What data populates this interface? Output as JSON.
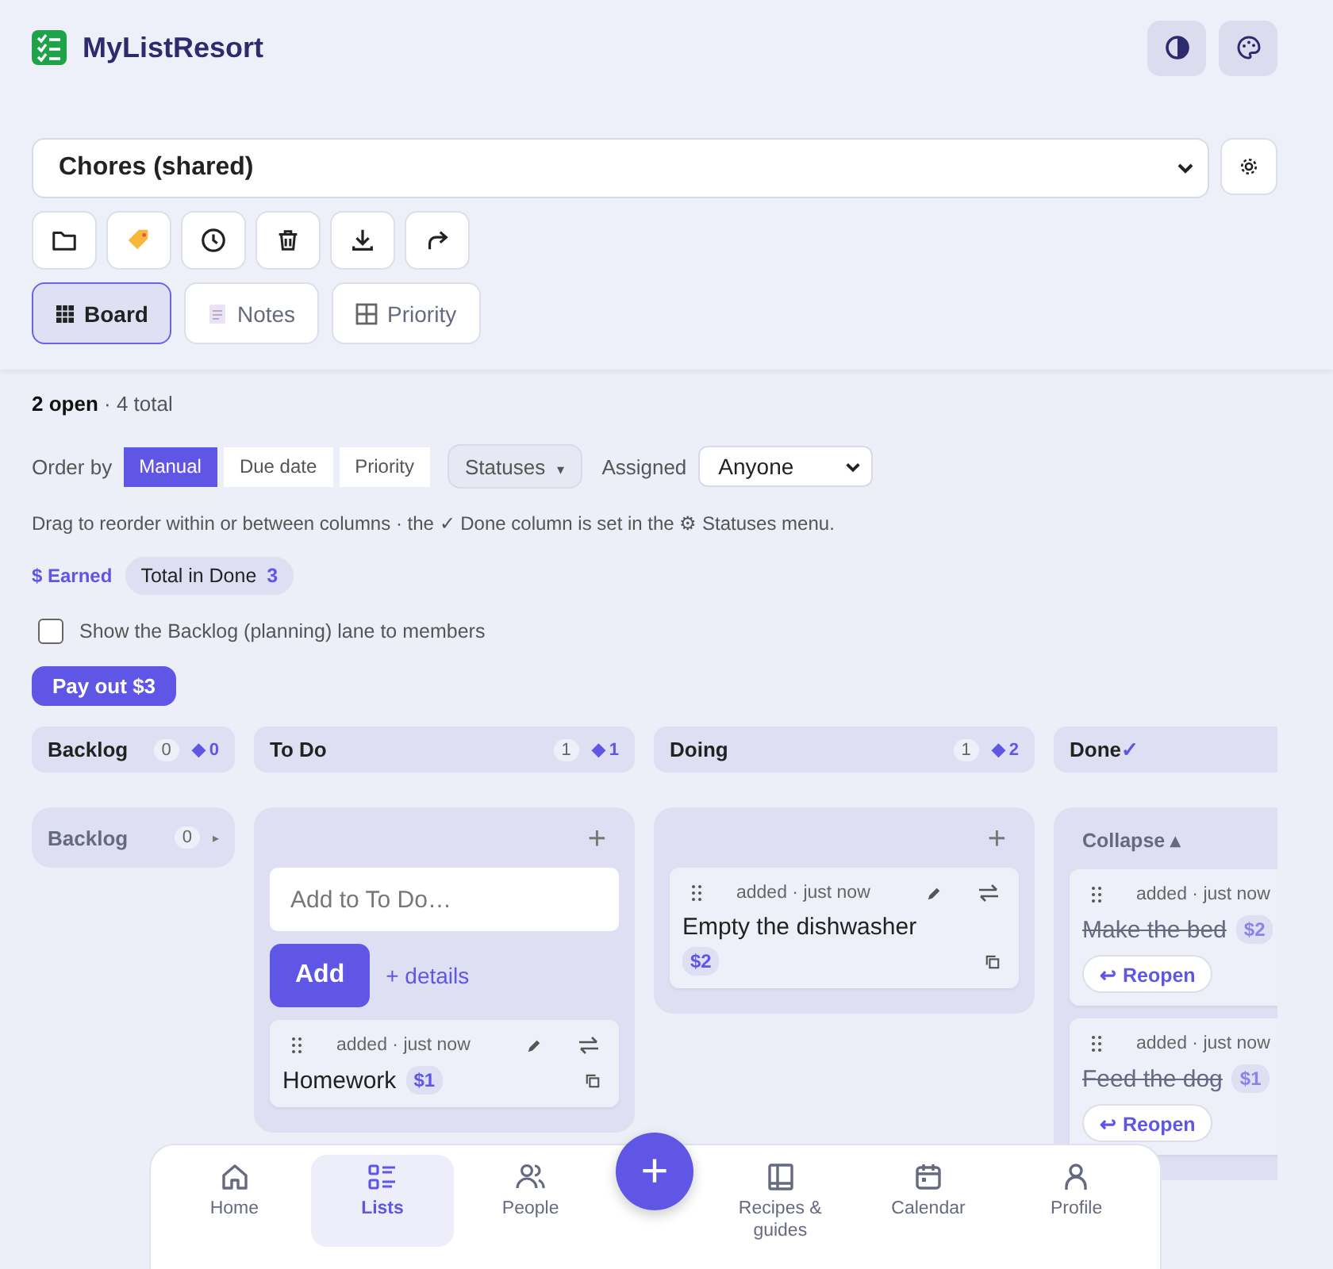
{
  "app": {
    "title": "MyListResort"
  },
  "list_select": {
    "value": "Chores (shared)"
  },
  "views": [
    {
      "label": "Board",
      "kind": "board",
      "selected": true
    },
    {
      "label": "Notes",
      "kind": "notes",
      "selected": false
    },
    {
      "label": "Priority",
      "kind": "priority",
      "selected": false
    }
  ],
  "summary": "**2 open** · 4 total",
  "order_by": {
    "label": "Order by",
    "options": [
      {
        "label": "Manual",
        "selected": true
      },
      {
        "label": "Due date",
        "selected": false
      },
      {
        "label": "Priority",
        "selected": false
      }
    ]
  },
  "statuses_button": {
    "label": "Statuses",
    "caret": "▾"
  },
  "assigned": {
    "label": "Assigned",
    "value": "Anyone"
  },
  "hint": "Drag to reorder within or between columns · the ✓ Done column is set in the ⚙ Statuses menu.",
  "earned": {
    "label": "$ Earned",
    "chip_label": "Total in Done",
    "chip_value": "3"
  },
  "backlog_option": {
    "label": "Show the Backlog (planning) lane to members",
    "checked": false
  },
  "pay_out": "Pay out $3",
  "column_headers": [
    {
      "name": "Backlog",
      "count": "0",
      "points": "◆ 0",
      "kind": "narrow"
    },
    {
      "name": "To Do",
      "count": "1",
      "points": "◆ 1",
      "kind": "wide"
    },
    {
      "name": "Doing",
      "count": "1",
      "points": "◆ 2",
      "kind": "wide"
    },
    {
      "name": "Done",
      "check": "✓",
      "kind": "wide"
    }
  ],
  "lanes": [
    {
      "kind": "collapsed",
      "name": "Backlog",
      "count": "0",
      "toggle": "▸"
    },
    {
      "kind": "open",
      "add_symbol": "+",
      "input": {
        "placeholder": "Add to To Do…"
      },
      "add_button": "Add",
      "details_link": "+ details",
      "cards": [
        {
          "meta": "added · just now",
          "title": "Homework",
          "price": "$1",
          "done": false
        }
      ]
    },
    {
      "kind": "open",
      "add_symbol": "+",
      "cards": [
        {
          "meta": "added · just now",
          "title": "Empty the dishwasher",
          "price": "$2",
          "done": false
        }
      ]
    },
    {
      "kind": "done",
      "collapse": "Collapse ▴",
      "cards": [
        {
          "meta": "added · just now",
          "title": "Make the bed",
          "price": "$2",
          "done": true,
          "reopen": "↩ Reopen"
        },
        {
          "meta": "added · just now",
          "title": "Feed the dog",
          "price": "$1",
          "done": true,
          "reopen": "↩ Reopen"
        }
      ]
    }
  ],
  "nav": {
    "fab": "+",
    "items": [
      {
        "label": "Home",
        "kind": "home",
        "selected": false
      },
      {
        "label": "Lists",
        "kind": "lists",
        "selected": true
      },
      {
        "label": "People",
        "kind": "people",
        "selected": false
      },
      {
        "label": "Recipes & guides",
        "kind": "book",
        "selected": false
      },
      {
        "label": "Calendar",
        "kind": "calendar",
        "selected": false
      },
      {
        "label": "Profile",
        "kind": "profile",
        "selected": false
      }
    ]
  }
}
